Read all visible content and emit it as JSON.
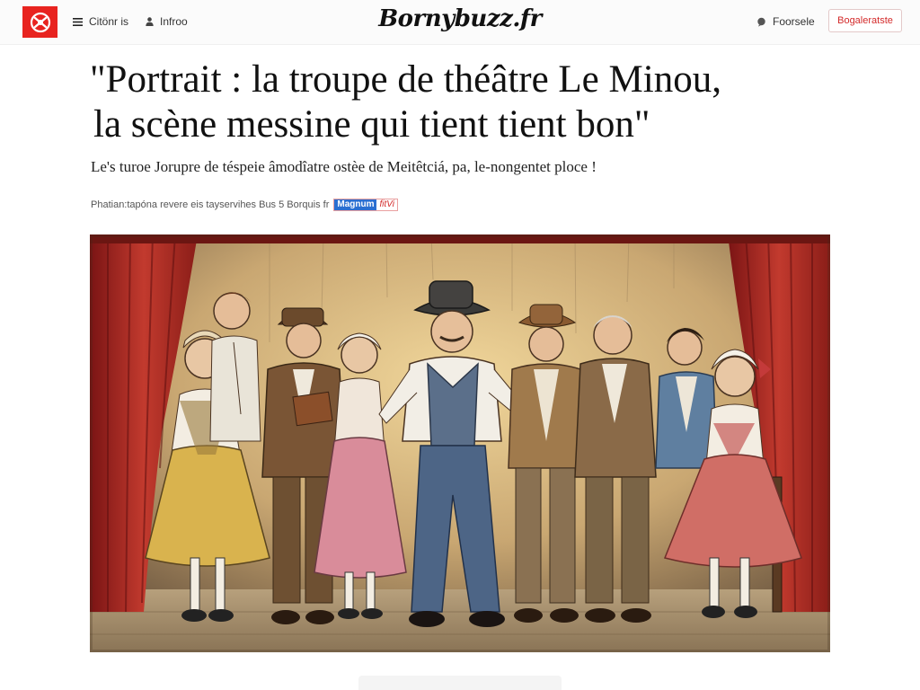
{
  "header": {
    "nav_menu_label": "Citönr is",
    "nav_info_label": "Infroo",
    "brand": "Bornybuzz.fr",
    "search_label": "Foorsele",
    "cta_label": "Bogaleratste",
    "accent_color": "#e8231f"
  },
  "article": {
    "headline_line1": "\"Portrait : la troupe de théâtre Le Minou,",
    "headline_line2": "la scène messine qui tient tient bon\"",
    "subtitle": "Le's turoe Jorupre de téspeie âmodîatre ostèe de Meitêtciá, pa, le-nongentet ploce !",
    "byline": "Phatian:tapóna revere eis tayservihes Bus 5 Borquis fr",
    "credit_badge_primary": "Magnum",
    "credit_badge_secondary": "fitVi"
  },
  "hero": {
    "description_icon": "theatre-illustration"
  }
}
